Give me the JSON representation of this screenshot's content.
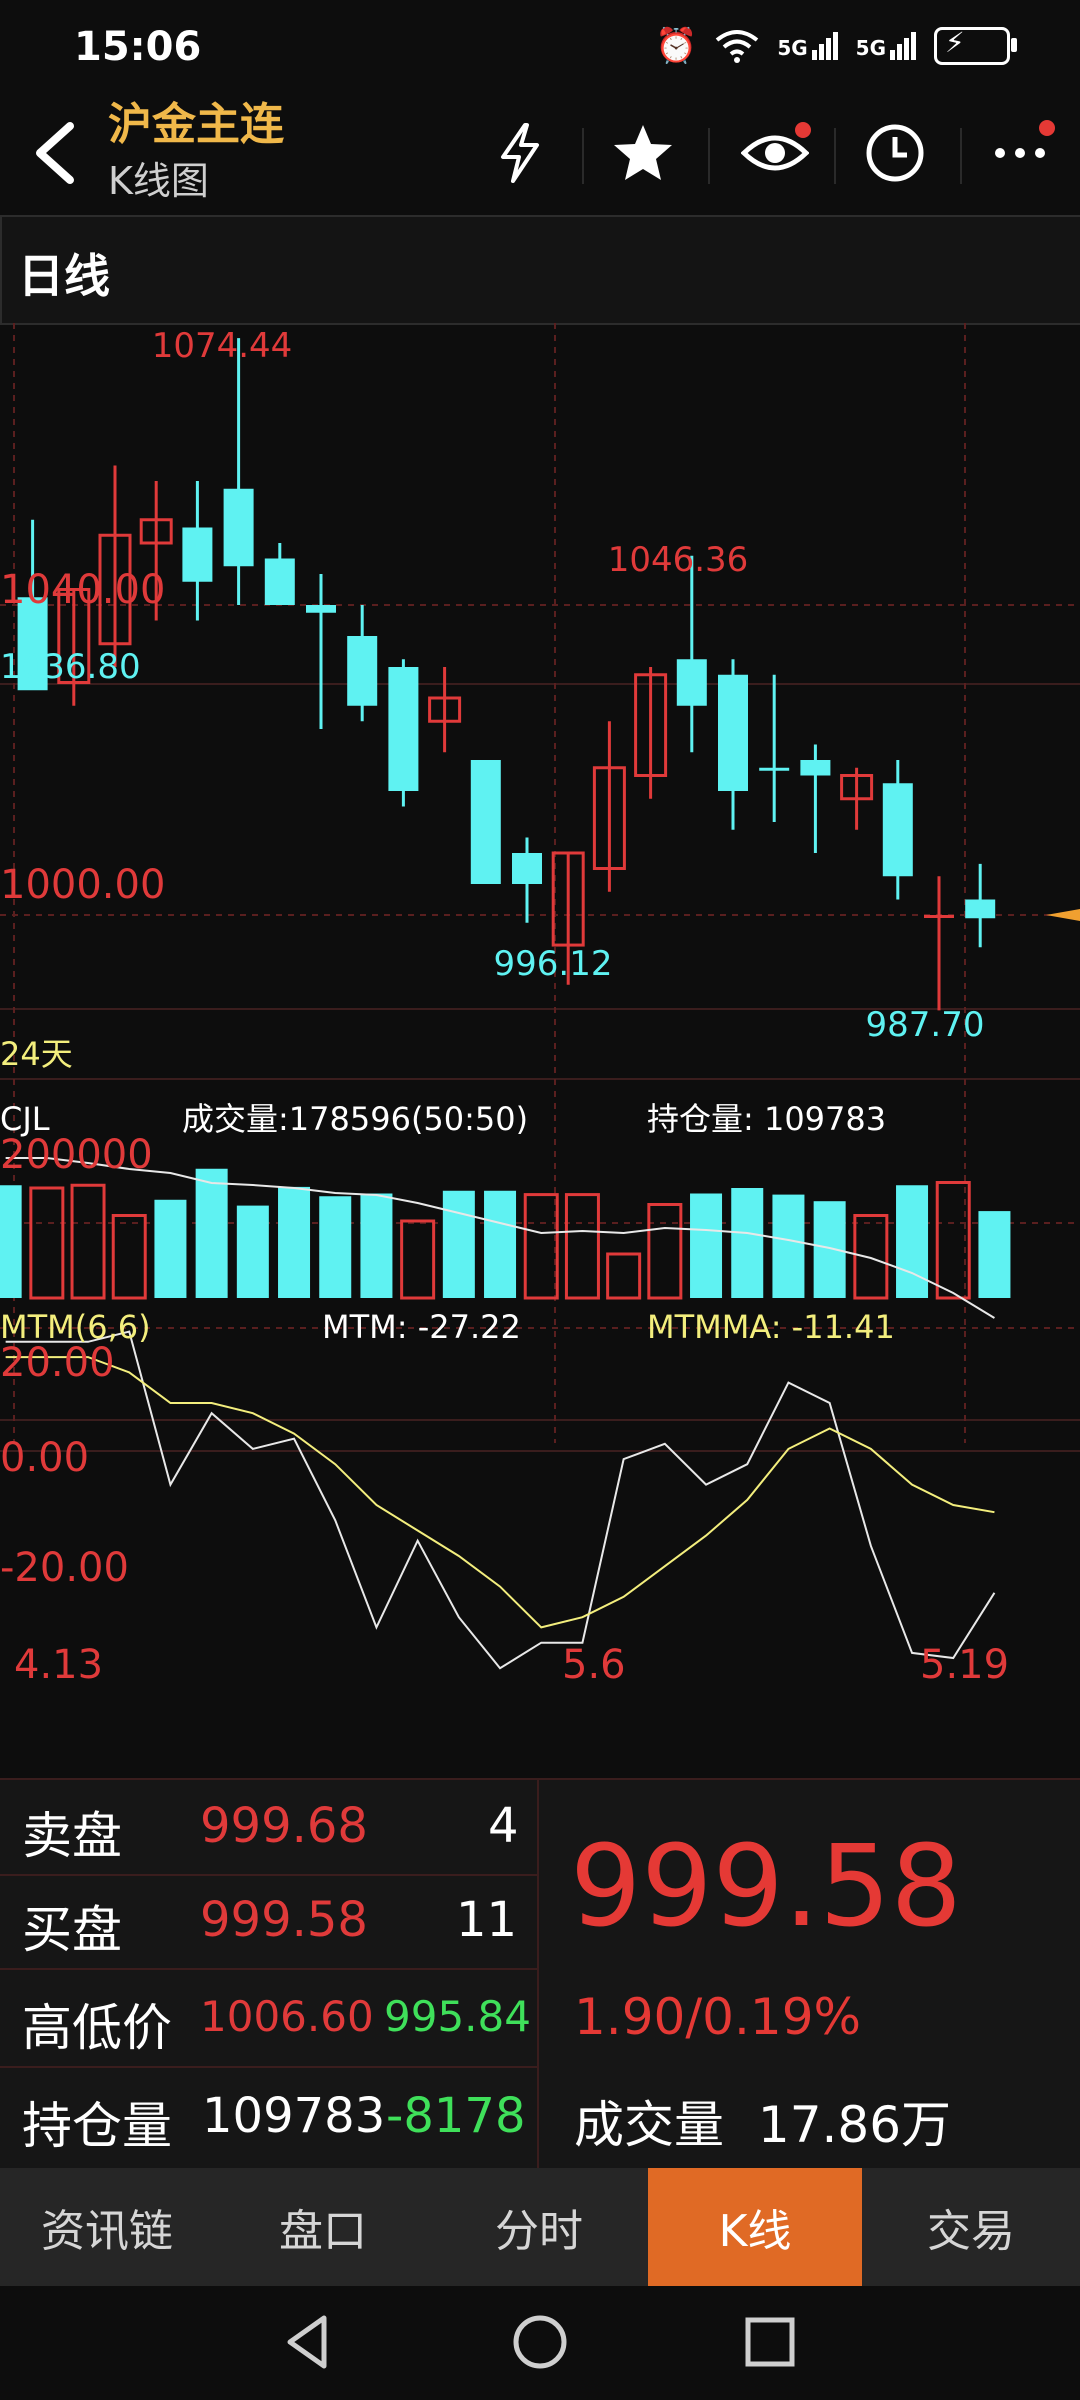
{
  "status_bar": {
    "time": "15:06",
    "icons": [
      "alarm-icon",
      "wifi-icon",
      "signal-5g-icon",
      "signal-5g-icon",
      "battery-charging-icon"
    ],
    "net1": "5G",
    "net2": "5G"
  },
  "header": {
    "title": "沪金主连",
    "subtitle": "K线图",
    "icons": [
      "back-icon",
      "lightning-icon",
      "star-icon",
      "eye-icon",
      "clock-icon",
      "more-icon"
    ]
  },
  "period": {
    "label": "日线"
  },
  "chart_data": [
    {
      "type": "candlestick",
      "dates": [
        "4.13",
        "",
        "",
        "",
        "",
        "",
        "",
        "",
        "",
        "",
        "",
        "",
        "",
        "5.6",
        "",
        "",
        "",
        "",
        "",
        "",
        "",
        "",
        "",
        "5.19"
      ],
      "candles": [
        {
          "o": 1041,
          "h": 1051,
          "l": 1034,
          "c": 1029,
          "dir": "down"
        },
        {
          "o": 1030,
          "h": 1042,
          "l": 1027,
          "c": 1042,
          "dir": "up"
        },
        {
          "o": 1035,
          "h": 1058,
          "l": 1032,
          "c": 1049,
          "dir": "up"
        },
        {
          "o": 1048,
          "h": 1056,
          "l": 1038,
          "c": 1051,
          "dir": "up"
        },
        {
          "o": 1050,
          "h": 1056,
          "l": 1038,
          "c": 1043,
          "dir": "down"
        },
        {
          "o": 1055,
          "h": 1074.44,
          "l": 1040,
          "c": 1045,
          "dir": "down"
        },
        {
          "o": 1046,
          "h": 1048,
          "l": 1040,
          "c": 1040,
          "dir": "down"
        },
        {
          "o": 1040,
          "h": 1044,
          "l": 1024,
          "c": 1039,
          "dir": "flat"
        },
        {
          "o": 1036,
          "h": 1040,
          "l": 1025,
          "c": 1027,
          "dir": "down"
        },
        {
          "o": 1032,
          "h": 1033,
          "l": 1014,
          "c": 1016,
          "dir": "down"
        },
        {
          "o": 1025,
          "h": 1032,
          "l": 1021,
          "c": 1028,
          "dir": "up"
        },
        {
          "o": 1020,
          "h": 1020,
          "l": 1004,
          "c": 1004,
          "dir": "down"
        },
        {
          "o": 1008,
          "h": 1010,
          "l": 999,
          "c": 1004,
          "dir": "down"
        },
        {
          "o": 996.12,
          "h": 1008,
          "l": 991,
          "c": 1008,
          "dir": "up"
        },
        {
          "o": 1006,
          "h": 1025,
          "l": 1003,
          "c": 1019,
          "dir": "up"
        },
        {
          "o": 1018,
          "h": 1032,
          "l": 1015,
          "c": 1031,
          "dir": "up"
        },
        {
          "o": 1033,
          "h": 1046.36,
          "l": 1021,
          "c": 1027,
          "dir": "down"
        },
        {
          "o": 1031,
          "h": 1033,
          "l": 1011,
          "c": 1016,
          "dir": "down"
        },
        {
          "o": 1019,
          "h": 1031,
          "l": 1012,
          "c": 1019,
          "dir": "flat"
        },
        {
          "o": 1020,
          "h": 1022,
          "l": 1008,
          "c": 1018,
          "dir": "down"
        },
        {
          "o": 1018,
          "h": 1019,
          "l": 1011,
          "c": 1015,
          "dir": "up"
        },
        {
          "o": 1017,
          "h": 1020,
          "l": 1002,
          "c": 1005,
          "dir": "down"
        },
        {
          "o": 1000,
          "h": 1005,
          "l": 987.7,
          "c": 1000,
          "dir": "flat"
        },
        {
          "o": 1002,
          "h": 1006.6,
          "l": 995.84,
          "c": 999.58,
          "dir": "down"
        }
      ],
      "price_labels": [
        "1040.00",
        "1000.00"
      ],
      "left_value": "1036.80",
      "annotations": {
        "high_1": "1074.44",
        "high_2": "1046.36",
        "low_1": "996.12",
        "low_2": "987.70"
      },
      "period_note": "24天"
    },
    {
      "type": "bar",
      "title": "CJL",
      "volume_label": "成交量:178596(50:50)",
      "open_interest_label": "持仓量: 109783",
      "ytick": "200000",
      "values": [
        205000,
        200000,
        205000,
        150000,
        178596,
        235000,
        168000,
        202000,
        185000,
        190000,
        140000,
        195000,
        195000,
        188000,
        188000,
        80000,
        170000,
        190000,
        200000,
        188000,
        176000,
        150000,
        205000,
        210000,
        158000
      ],
      "up": [
        false,
        true,
        true,
        true,
        false,
        false,
        false,
        false,
        false,
        false,
        true,
        false,
        false,
        true,
        true,
        true,
        true,
        false,
        false,
        false,
        false,
        true,
        false,
        true,
        false
      ]
    },
    {
      "type": "line",
      "title": "MTM(6,6)",
      "mtm_label": "MTM: -27.22",
      "mtmma_label": "MTMMA: -11.41",
      "yticks": [
        "20.00",
        "0.00",
        "-20.00"
      ],
      "series": [
        {
          "name": "MTM",
          "values": [
            22,
            22,
            22,
            24,
            -6,
            8,
            1,
            3,
            -13,
            -34,
            -17,
            -32,
            -42,
            -37,
            -37,
            -1,
            2,
            -6,
            -2,
            14,
            10,
            -18,
            -39,
            -40,
            -27.22
          ]
        },
        {
          "name": "MTMMA",
          "values": [
            19,
            19,
            19,
            16,
            10,
            10,
            8,
            4,
            -2,
            -10,
            -15,
            -20,
            -26,
            -34,
            -32,
            -28,
            -22,
            -16,
            -9,
            1,
            5,
            1,
            -6,
            -10,
            -11.41
          ]
        }
      ],
      "ylim": [
        -45,
        25
      ]
    }
  ],
  "date_axis": [
    "4.13",
    "5.6",
    "5.19"
  ],
  "quote_panel": {
    "sell_label": "卖盘",
    "sell_price": "999.68",
    "sell_qty": "4",
    "buy_label": "买盘",
    "buy_price": "999.58",
    "buy_qty": "11",
    "hilo_label": "高低价",
    "high": "1006.60",
    "low": "995.84",
    "oi_label": "持仓量",
    "oi_value": "109783",
    "oi_change": "-8178",
    "last_price": "999.58",
    "change": "1.90/0.19%",
    "volume_label": "成交量",
    "volume_value": "17.86万"
  },
  "tabs": [
    {
      "label": "资讯链"
    },
    {
      "label": "盘口"
    },
    {
      "label": "分时"
    },
    {
      "label": "K线",
      "active": true
    },
    {
      "label": "交易"
    }
  ],
  "colors": {
    "up": "#e03a3a",
    "down": "#5ff2f2",
    "accent": "#e06a25",
    "title": "#f0b84a",
    "mtmma": "#f3ee7d"
  }
}
